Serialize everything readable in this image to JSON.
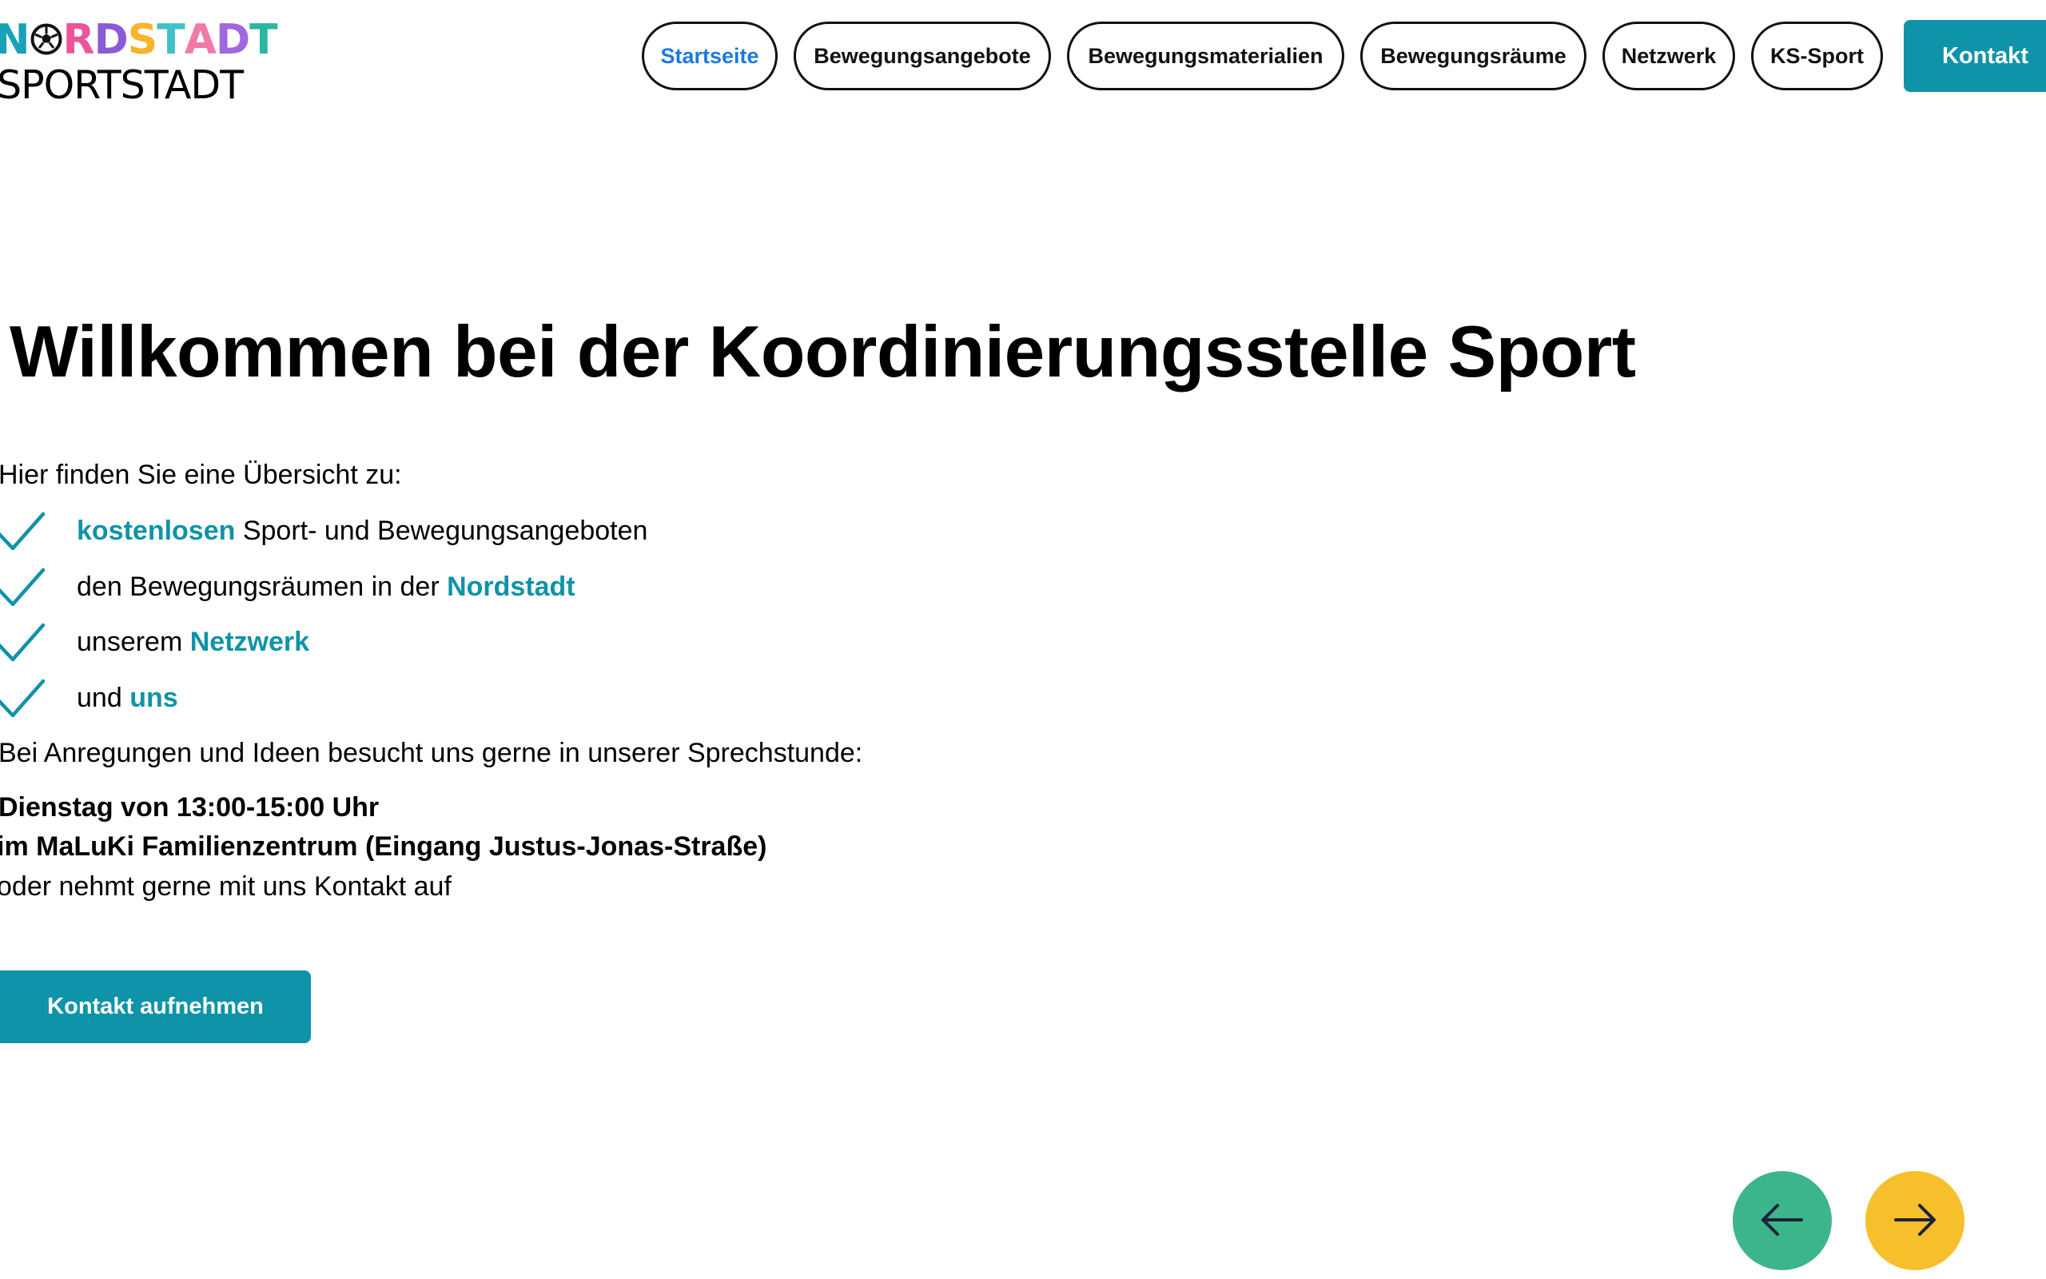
{
  "colors": {
    "teal": "#0f93a8",
    "link_blue": "#1b79e0",
    "arrow_prev": "#3db58a",
    "arrow_next": "#f8bf2d",
    "arrow_stroke": "#1c2238"
  },
  "logo": {
    "line1_letters": [
      {
        "ch": "N",
        "color": "#17a2b8"
      },
      {
        "ch": "O",
        "color": "#111111"
      },
      {
        "ch": "R",
        "color": "#e9559c"
      },
      {
        "ch": "D",
        "color": "#8a5bd6"
      },
      {
        "ch": "S",
        "color": "#f6b42c"
      },
      {
        "ch": "T",
        "color": "#3ec1c9"
      },
      {
        "ch": "A",
        "color": "#f07aa7"
      },
      {
        "ch": "D",
        "color": "#a068e0"
      },
      {
        "ch": "T",
        "color": "#2bb6a0"
      }
    ],
    "line2": "SPORTSTADT",
    "ball_icon": "soccer-ball-icon"
  },
  "nav": {
    "items": [
      {
        "label": "Startseite",
        "active": true
      },
      {
        "label": "Bewegungsangebote",
        "active": false
      },
      {
        "label": "Bewegungsmaterialien",
        "active": false
      },
      {
        "label": "Bewegungsräume",
        "active": false
      },
      {
        "label": "Netzwerk",
        "active": false
      },
      {
        "label": "KS-Sport",
        "active": false
      }
    ],
    "contact_label": "Kontakt"
  },
  "main": {
    "title": "Willkommen bei der Koordinierungsstelle Sport",
    "intro": "Hier finden Sie eine Übersicht zu:",
    "checklist": [
      {
        "pre": "",
        "hl": "kostenlosen",
        "post": " Sport- und Bewegungsangeboten"
      },
      {
        "pre": "den Bewegungsräumen in der ",
        "hl": "Nordstadt",
        "post": ""
      },
      {
        "pre": "unserem ",
        "hl": "Netzwerk",
        "post": ""
      },
      {
        "pre": "und ",
        "hl": "uns",
        "post": ""
      }
    ],
    "check_icon": "checkmark-icon",
    "hint": "Bei Anregungen und Ideen besucht uns gerne in unserer Sprechstunde:",
    "hours": "Dienstag von 13:00-15:00 Uhr",
    "place": "im MaLuKi Familienzentrum (Eingang Justus-Jonas-Straße)",
    "contact_hint": "oder nehmt gerne mit uns Kontakt auf",
    "cta_label": "Kontakt aufnehmen"
  },
  "carousel": {
    "prev_icon": "arrow-left-icon",
    "next_icon": "arrow-right-icon"
  }
}
